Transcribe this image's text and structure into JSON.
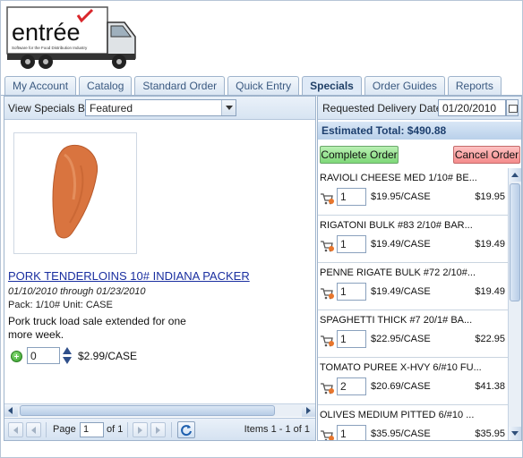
{
  "brand": {
    "logo_text": "entrée",
    "logo_tagline": "Software for the Food Distribution Industry"
  },
  "tabs": [
    {
      "label": "My Account"
    },
    {
      "label": "Catalog"
    },
    {
      "label": "Standard Order"
    },
    {
      "label": "Quick Entry"
    },
    {
      "label": "Specials",
      "active": true
    },
    {
      "label": "Order Guides"
    },
    {
      "label": "Reports"
    }
  ],
  "specials": {
    "view_by_label": "View Specials By",
    "view_by_value": "Featured",
    "product": {
      "name": "PORK TENDERLOINS 10# INDIANA PACKER",
      "dates": "01/10/2010 through 01/23/2010",
      "pack": "Pack: 1/10# Unit: CASE",
      "description": "Pork truck load sale extended for one more week.",
      "quantity": "0",
      "price": "$2.99/CASE"
    },
    "pager": {
      "page_label": "Page",
      "page_value": "1",
      "of_label": "of 1",
      "items_label": "Items 1 - 1 of 1"
    }
  },
  "order": {
    "delivery_label": "Requested Delivery Date:",
    "delivery_date": "01/20/2010",
    "estimated_total": "Estimated Total: $490.88",
    "complete_label": "Complete Order",
    "cancel_label": "Cancel Order",
    "items": [
      {
        "name": "RAVIOLI CHEESE MED 1/10# BE...",
        "qty": "1",
        "unit_price": "$19.95/CASE",
        "extended": "$19.95"
      },
      {
        "name": "RIGATONI BULK #83 2/10# BAR...",
        "qty": "1",
        "unit_price": "$19.49/CASE",
        "extended": "$19.49"
      },
      {
        "name": "PENNE RIGATE BULK #72 2/10#...",
        "qty": "1",
        "unit_price": "$19.49/CASE",
        "extended": "$19.49"
      },
      {
        "name": "SPAGHETTI THICK #7 20/1# BA...",
        "qty": "1",
        "unit_price": "$22.95/CASE",
        "extended": "$22.95"
      },
      {
        "name": "TOMATO PUREE X-HVY 6/#10 FU...",
        "qty": "2",
        "unit_price": "$20.69/CASE",
        "extended": "$41.38"
      },
      {
        "name": "OLIVES MEDIUM PITTED 6/#10 ...",
        "qty": "1",
        "unit_price": "$35.95/CASE",
        "extended": "$35.95"
      }
    ]
  },
  "colors": {
    "tab_active_text": "#1f3f66",
    "link": "#1a2fa0",
    "complete_button": "#7ed878",
    "cancel_button": "#f48b8b",
    "logo_check": "#d9262b"
  }
}
